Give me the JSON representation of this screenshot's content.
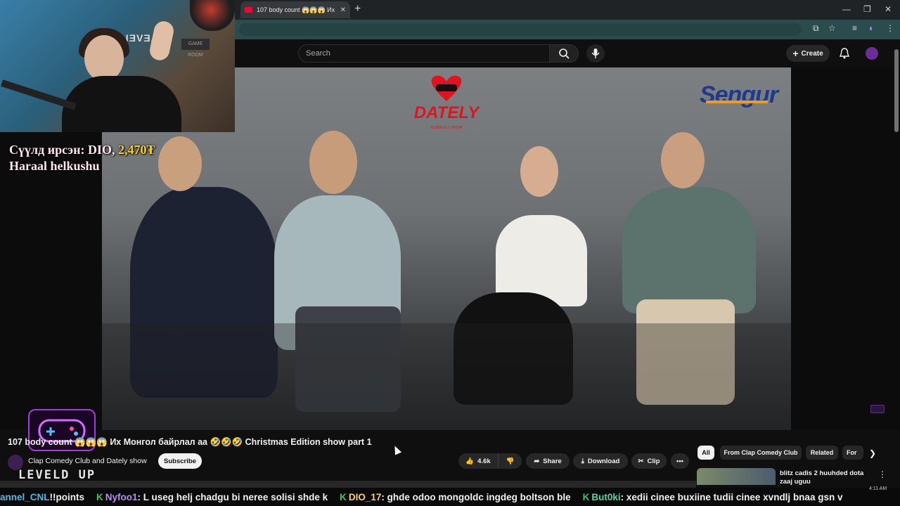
{
  "browser": {
    "tab_title": "107 body count 😱😱😱 Их М",
    "new_tab_icon": "plus-icon",
    "window_controls": [
      "minimize-icon",
      "restore-icon",
      "close-icon"
    ]
  },
  "masthead": {
    "search_placeholder": "Search",
    "create_label": "Create"
  },
  "video": {
    "show_logo_text": "DATELY",
    "show_logo_subtext": "BLINDFOLD SHOW",
    "sponsor_logo_text": "Sengur"
  },
  "stream_overlay": {
    "donation_prefix": "Сүүлд ирсэн: DIO,",
    "donation_amount": "2,470₮",
    "donation_message": "Haraal helkushu",
    "brand_text": "LEVELD UP",
    "webcam_sign": "GAME ROOM",
    "webcam_shirt_text": "LEVELD"
  },
  "watch": {
    "title": "107 body count 😱😱😱 Их Монгол байрлал аа 🤣🤣🤣 Christmas Edition show part 1",
    "channel_name": "Clap Comedy Club and Dately show",
    "subscribe_label": "Subscribe",
    "like_count": "4.6k",
    "share_label": "Share",
    "download_label": "Download",
    "clip_label": "Clip"
  },
  "sidebar": {
    "chips": [
      "All",
      "From Clap Comedy Club",
      "Related",
      "For"
    ],
    "rec_title": "blitz cadis 2 huuhded dota zaaj uguu"
  },
  "ticker": [
    {
      "user": "annel_CNL",
      "msg": "!!points"
    },
    {
      "user": "Nyfoo1",
      "msg": ": L useg helj chadgu bi neree solisi shde k"
    },
    {
      "user": "DIO_17",
      "msg": ": ghde odoo mongoldc ingdeg boltson ble"
    },
    {
      "user": "But0ki",
      "msg": ": xedii cinee buxiine tudii cinee xvndlj bnaa gsn v"
    }
  ],
  "clock": "4:11 AM",
  "colors": {
    "accent_red": "#ff0033",
    "donation_gold": "#ffd400",
    "addressbar_teal": "#2a4c4c",
    "overlay_purple": "#a23cd8"
  }
}
